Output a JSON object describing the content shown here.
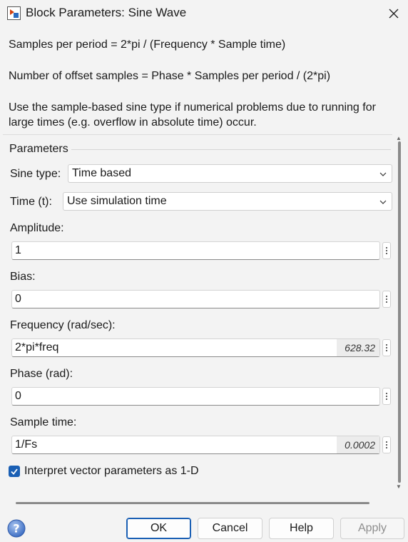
{
  "window": {
    "title": "Block Parameters: Sine Wave"
  },
  "description": {
    "line1": "Samples per period = 2*pi / (Frequency * Sample time)",
    "line2": "Number of offset samples = Phase * Samples per period / (2*pi)",
    "line3a": "Use the sample-based sine type if numerical problems due to running for",
    "line3b": "large times (e.g. overflow in absolute time) occur."
  },
  "parameters": {
    "group_label": "Parameters",
    "sine_type": {
      "label": "Sine type:",
      "value": "Time based"
    },
    "time": {
      "label": "Time (t):",
      "value": "Use simulation time"
    },
    "amplitude": {
      "label": "Amplitude:",
      "value": "1"
    },
    "bias": {
      "label": "Bias:",
      "value": "0"
    },
    "frequency": {
      "label": "Frequency (rad/sec):",
      "value": "2*pi*freq",
      "evaluated": "628.32"
    },
    "phase": {
      "label": "Phase (rad):",
      "value": "0"
    },
    "sample_time": {
      "label": "Sample time:",
      "value": "1/Fs",
      "evaluated": "0.0002"
    },
    "interpret_vector": {
      "label": "Interpret vector parameters as 1-D",
      "checked": true
    }
  },
  "buttons": {
    "ok": "OK",
    "cancel": "Cancel",
    "help": "Help",
    "apply": "Apply"
  },
  "colors": {
    "accent": "#1a5fb4",
    "background": "#f3f3f3"
  },
  "icons": [
    "simulink-block-icon",
    "close-icon",
    "chevron-down-icon",
    "kebab-menu-icon",
    "checkmark-icon",
    "help-icon"
  ]
}
